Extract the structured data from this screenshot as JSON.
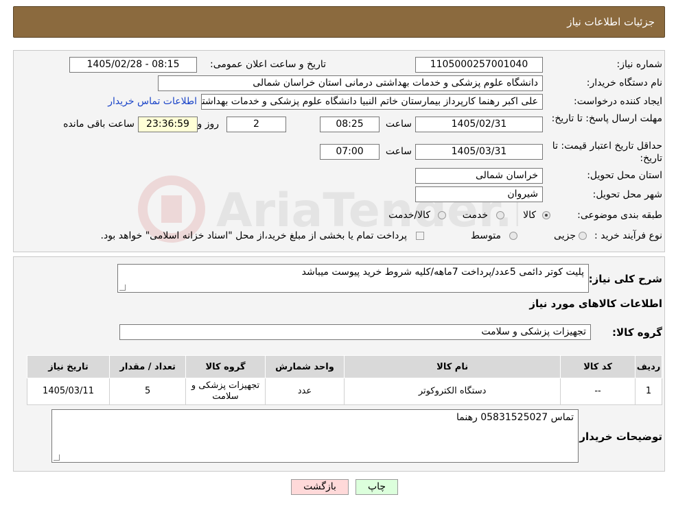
{
  "header": {
    "title": "جزئیات اطلاعات نیاز"
  },
  "labels": {
    "need_number": "شماره نیاز:",
    "announce_datetime": "تاریخ و ساعت اعلان عمومی:",
    "buyer_org": "نام دستگاه خریدار:",
    "requester": "ایجاد کننده درخواست:",
    "send_deadline": "مهلت ارسال پاسخ: تا تاریخ:",
    "hour": "ساعت",
    "day_and": "روز و",
    "remaining": "ساعت باقی مانده",
    "min_validity": "حداقل تاریخ اعتبار قیمت: تا تاریخ:",
    "hour2": "ساعت",
    "province": "استان محل تحویل:",
    "city": "شهر محل تحویل:",
    "category": "طبقه بندی موضوعی:",
    "process_type": "نوع فرآیند خرید :",
    "description": "شرح کلی نیاز:",
    "goods_info": "اطلاعات کالاهای مورد نیاز",
    "goods_group": "گروه کالا:",
    "buyer_notes": "توضیحات خریدار:"
  },
  "values": {
    "need_number": "1105000257001040",
    "announce_datetime": "1405/02/28 - 08:15",
    "buyer_org": "دانشگاه علوم پزشکی و خدمات بهداشتی درمانی استان خراسان شمالی",
    "requester": "علی اکبر رهنما کارپرداز بیمارستان خاتم النبیا دانشگاه علوم پزشکی و خدمات بهداشتی",
    "contact_link": "اطلاعات تماس خریدار",
    "send_date": "1405/02/31",
    "send_time": "08:25",
    "days": "2",
    "remaining_time": "23:36:59",
    "validity_date": "1405/03/31",
    "validity_time": "07:00",
    "province": "خراسان شمالی",
    "city": "شیروان",
    "description": "پلیت کوتر دائمی 5عدد/پرداخت 7ماهه/کلیه شروط خرید پیوست میباشد",
    "goods_group": "تجهیزات پزشکی و سلامت",
    "buyer_notes": "تماس 05831525027 رهنما"
  },
  "category_options": [
    {
      "label": "کالا",
      "selected": true
    },
    {
      "label": "خدمت",
      "selected": false
    },
    {
      "label": "کالا/خدمت",
      "selected": false
    }
  ],
  "process_options": [
    {
      "label": "جزیی",
      "selected": false
    },
    {
      "label": "متوسط",
      "selected": false
    }
  ],
  "process_note": "پرداخت تمام یا بخشی از مبلغ خرید،از محل \"اسناد خزانه اسلامی\" خواهد بود.",
  "table": {
    "headers": [
      "ردیف",
      "کد کالا",
      "نام کالا",
      "واحد شمارش",
      "گروه کالا",
      "تعداد / مقدار",
      "تاریخ نیاز"
    ],
    "rows": [
      [
        "1",
        "--",
        "دستگاه الکتروکوتر",
        "عدد",
        "تجهیزات پزشکی و سلامت",
        "5",
        "1405/03/11"
      ]
    ]
  },
  "buttons": {
    "print": "چاپ",
    "back": "بازگشت"
  },
  "watermark": {
    "text": "AriaTender.neT"
  },
  "colors": {
    "header_bg": "#8b6a3e",
    "link": "#1a44c8",
    "back_button_bg": "#ffd9d9",
    "print_button_bg": "#dcffdc",
    "remaining_bg": "#ffffd6"
  }
}
